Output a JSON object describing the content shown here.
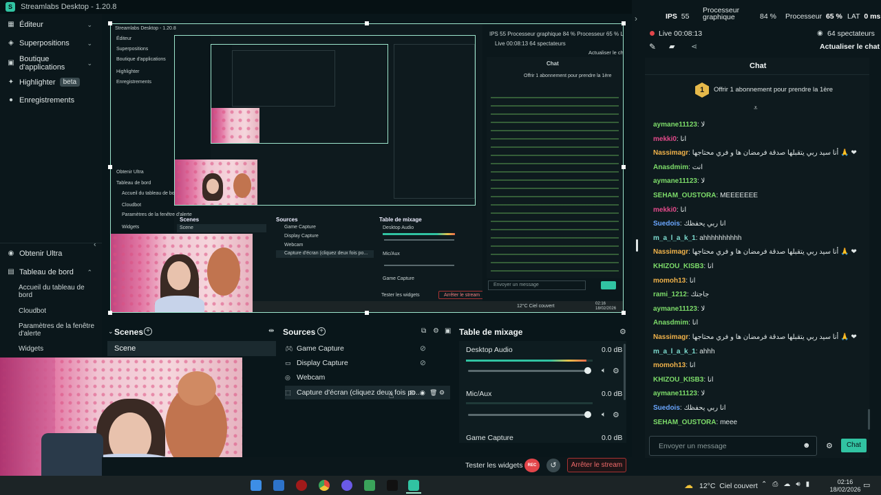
{
  "window": {
    "title": "Streamlabs Desktop - 1.20.8"
  },
  "sidebar": {
    "items": [
      {
        "label": "Éditeur",
        "icon": "editor-icon"
      },
      {
        "label": "Superpositions",
        "icon": "overlays-icon"
      },
      {
        "label": "Boutique d'applications",
        "icon": "app-store-icon"
      },
      {
        "label": "Highlighter",
        "badge": "beta",
        "icon": "highlighter-icon"
      },
      {
        "label": "Enregistrements",
        "icon": "recordings-icon"
      }
    ],
    "bottom": {
      "ultra": "Obtenir Ultra",
      "dashboard": "Tableau de bord",
      "dashboard_items": [
        "Accueil du tableau de bord",
        "Cloudbot",
        "Paramètres de la fenêtre d'alerte",
        "Widgets"
      ]
    }
  },
  "docks": {
    "scenes": {
      "title": "Scenes",
      "items": [
        "Scene"
      ]
    },
    "sources": {
      "title": "Sources",
      "items": [
        {
          "label": "Game Capture",
          "icon": "game-capture-icon"
        },
        {
          "label": "Display Capture",
          "icon": "display-capture-icon"
        },
        {
          "label": "Webcam",
          "icon": "webcam-icon"
        },
        {
          "label": "Capture d'écran (cliquez deux fois po...",
          "icon": "screen-capture-icon"
        }
      ]
    },
    "mixer": {
      "title": "Table de mixage",
      "channels": [
        {
          "name": "Desktop Audio",
          "db": "0.0 dB",
          "level": 0.95,
          "volume": 0.98
        },
        {
          "name": "Mic/Aux",
          "db": "0.0 dB",
          "level": 0.0,
          "volume": 0.98
        },
        {
          "name": "Game Capture",
          "db": "0.0 dB",
          "level": 0.0,
          "volume": 0.98
        }
      ]
    }
  },
  "footer": {
    "test_widgets": "Tester les widgets",
    "rec_label": "REC",
    "stop_stream": "Arrêter le stream"
  },
  "stats": {
    "fps_label": "IPS",
    "fps_value": "55",
    "gpu_label": "Processeur graphique",
    "gpu_value": "84 %",
    "cpu_label": "Processeur",
    "cpu_value": "65 %",
    "lat_label": "LAT",
    "lat_value": "0 ms"
  },
  "live": {
    "status": "Live 00:08:13",
    "viewers": "64 spectateurs",
    "refresh_chat": "Actualiser le chat"
  },
  "chat": {
    "title": "Chat",
    "offer_badge": "1",
    "offer": "Offrir 1 abonnement pour prendre la 1ère",
    "messages": [
      {
        "user": "aymane11123",
        "text": "لا",
        "color": "#7ddc6a"
      },
      {
        "user": "mekki0",
        "text": "انا",
        "color": "#e24a8a"
      },
      {
        "user": "Nassimagr",
        "text": "أنا سيد ربي يتقبلها صدقة فرمضان ها و فري محتاجها 🙏 ❤",
        "color": "#f0b24a"
      },
      {
        "user": "Anasdmim",
        "text": "انت",
        "color": "#7ddc6a"
      },
      {
        "user": "aymane11123",
        "text": "لا",
        "color": "#7ddc6a"
      },
      {
        "user": "SEHAM_OUSTORA",
        "text": "MEEEEEEE",
        "color": "#7ddc6a"
      },
      {
        "user": "mekki0",
        "text": "انا",
        "color": "#e24a8a"
      },
      {
        "user": "Suedois",
        "text": "انا ربي يحفظك",
        "color": "#6aa6ff"
      },
      {
        "user": "m_a_l_a_k_1",
        "text": "ahhhhhhhhhh",
        "color": "#7ddcd0"
      },
      {
        "user": "Nassimagr",
        "text": "أنا سيد ربي يتقبلها صدقة فرمضان ها و فري محتاجها 🙏 ❤",
        "color": "#f0b24a"
      },
      {
        "user": "KHIZOU_KISB3",
        "text": "انا",
        "color": "#7ddc6a"
      },
      {
        "user": "momoh13",
        "text": "انا",
        "color": "#f0b24a"
      },
      {
        "user": "rami_1212",
        "text": "جاجتك",
        "color": "#7ddc6a"
      },
      {
        "user": "aymane11123",
        "text": "لا",
        "color": "#7ddc6a"
      },
      {
        "user": "Anasdmim",
        "text": "انا",
        "color": "#7ddc6a"
      },
      {
        "user": "Nassimagr",
        "text": "أنا سيد ربي يتقبلها صدقة فرمضان ها و فري محتاجها 🙏 ❤",
        "color": "#f0b24a"
      },
      {
        "user": "m_a_l_a_k_1",
        "text": "ahhh",
        "color": "#7ddcd0"
      },
      {
        "user": "momoh13",
        "text": "انا",
        "color": "#f0b24a"
      },
      {
        "user": "KHIZOU_KISB3",
        "text": "انا",
        "color": "#7ddc6a"
      },
      {
        "user": "aymane11123",
        "text": "لا",
        "color": "#7ddc6a"
      },
      {
        "user": "Suedois",
        "text": "انا ربي يحفظك",
        "color": "#6aa6ff"
      },
      {
        "user": "SEHAM_OUSTORA",
        "text": "meee",
        "color": "#7ddc6a"
      }
    ],
    "input_placeholder": "Envoyer un message",
    "send_label": "Chat"
  },
  "taskbar": {
    "weather": "12°C  Ciel couvert",
    "time": "02:16",
    "date": "18/02/2026"
  },
  "colors": {
    "accent": "#31c3a2",
    "live_red": "#e2454a",
    "stop_red": "#e2454a"
  }
}
